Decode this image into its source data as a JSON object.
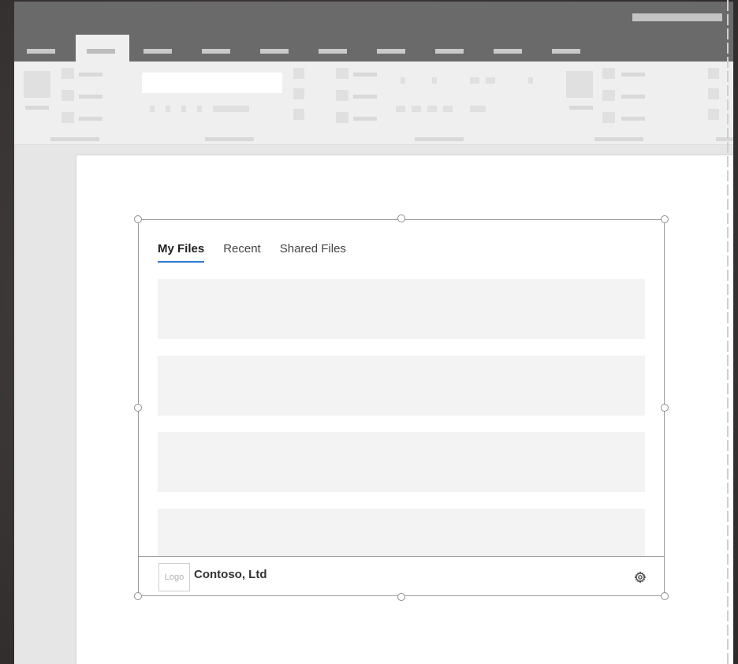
{
  "addin": {
    "tabs": [
      {
        "label": "My Files",
        "selected": true
      },
      {
        "label": "Recent",
        "selected": false
      },
      {
        "label": "Shared Files",
        "selected": false
      }
    ],
    "file_rows": 4,
    "footer": {
      "logo_text": "Logo",
      "company": "Contoso, Ltd",
      "settings_icon": "gear-icon"
    }
  },
  "colors": {
    "accent": "#2b7bd1",
    "titlebar": "#6a6a6a",
    "ribbon": "#efefef",
    "row_placeholder": "#f3f3f3"
  }
}
